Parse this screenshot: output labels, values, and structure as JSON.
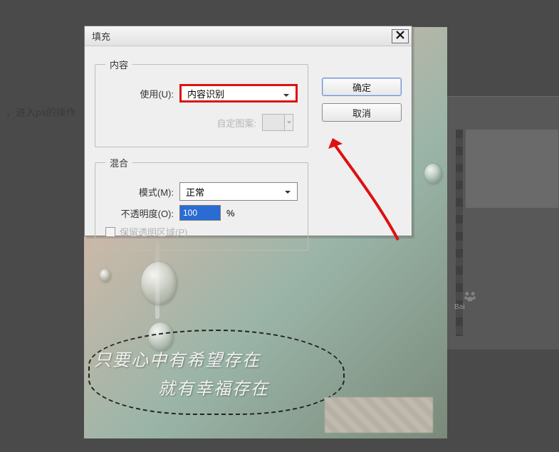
{
  "page": {
    "intro_text": "，进入ps的操作"
  },
  "dialog": {
    "title": "填充",
    "buttons": {
      "ok": "确定",
      "cancel": "取消"
    }
  },
  "content_group": {
    "legend": "内容",
    "use_label": "使用(U):",
    "use_value": "内容识别",
    "pattern_label": "自定图案:"
  },
  "blend_group": {
    "legend": "混合",
    "mode_label": "模式(M):",
    "mode_value": "正常",
    "opacity_label": "不透明度(O):",
    "opacity_value": "100",
    "opacity_unit": "%",
    "preserve_trans_label": "保留透明区域(P)"
  },
  "canvas": {
    "line1": "只要心中有希望存在",
    "line2": "就有幸福存在"
  },
  "bg": {
    "watermark": "Bai"
  }
}
